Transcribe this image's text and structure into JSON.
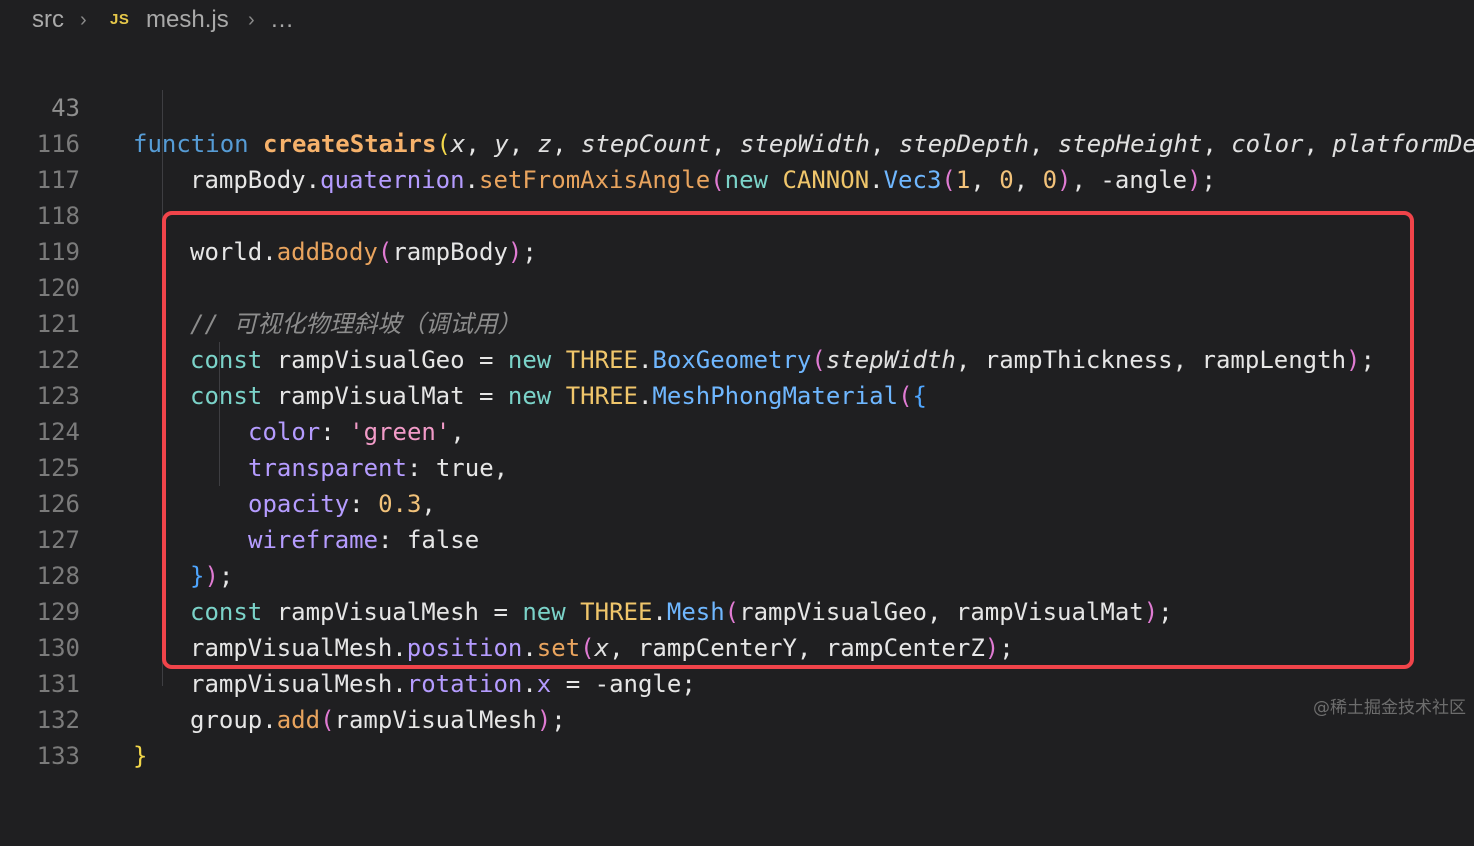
{
  "breadcrumb": {
    "folder": "src",
    "file_badge": "JS",
    "file": "mesh.js",
    "more": "…"
  },
  "lines": [
    {
      "num": "43",
      "text": "function createStairs(x, y, z, stepCount, stepWidth, stepDepth, stepHeight, color, platformDe"
    },
    {
      "num": "116",
      "text": "rampBody.quaternion.setFromAxisAngle(new CANNON.Vec3(1, 0, 0), -angle);"
    },
    {
      "num": "117",
      "text": ""
    },
    {
      "num": "118",
      "text": "world.addBody(rampBody);"
    },
    {
      "num": "119",
      "text": ""
    },
    {
      "num": "120",
      "text": "// 可视化物理斜坡（调试用）"
    },
    {
      "num": "121",
      "text": "const rampVisualGeo = new THREE.BoxGeometry(stepWidth, rampThickness, rampLength);"
    },
    {
      "num": "122",
      "text": "const rampVisualMat = new THREE.MeshPhongMaterial({"
    },
    {
      "num": "123",
      "text": "color: 'green',"
    },
    {
      "num": "124",
      "text": "transparent: true,"
    },
    {
      "num": "125",
      "text": "opacity: 0.3,"
    },
    {
      "num": "126",
      "text": "wireframe: false"
    },
    {
      "num": "127",
      "text": "});"
    },
    {
      "num": "128",
      "text": "const rampVisualMesh = new THREE.Mesh(rampVisualGeo, rampVisualMat);"
    },
    {
      "num": "129",
      "text": "rampVisualMesh.position.set(x, rampCenterY, rampCenterZ);"
    },
    {
      "num": "130",
      "text": "rampVisualMesh.rotation.x = -angle;"
    },
    {
      "num": "131",
      "text": "group.add(rampVisualMesh);"
    },
    {
      "num": "132",
      "text": "}"
    },
    {
      "num": "133",
      "text": ""
    }
  ],
  "watermark": "@稀土掘金技术社区",
  "colors": {
    "background": "#1f1f21",
    "highlight_border": "#f0444a"
  }
}
